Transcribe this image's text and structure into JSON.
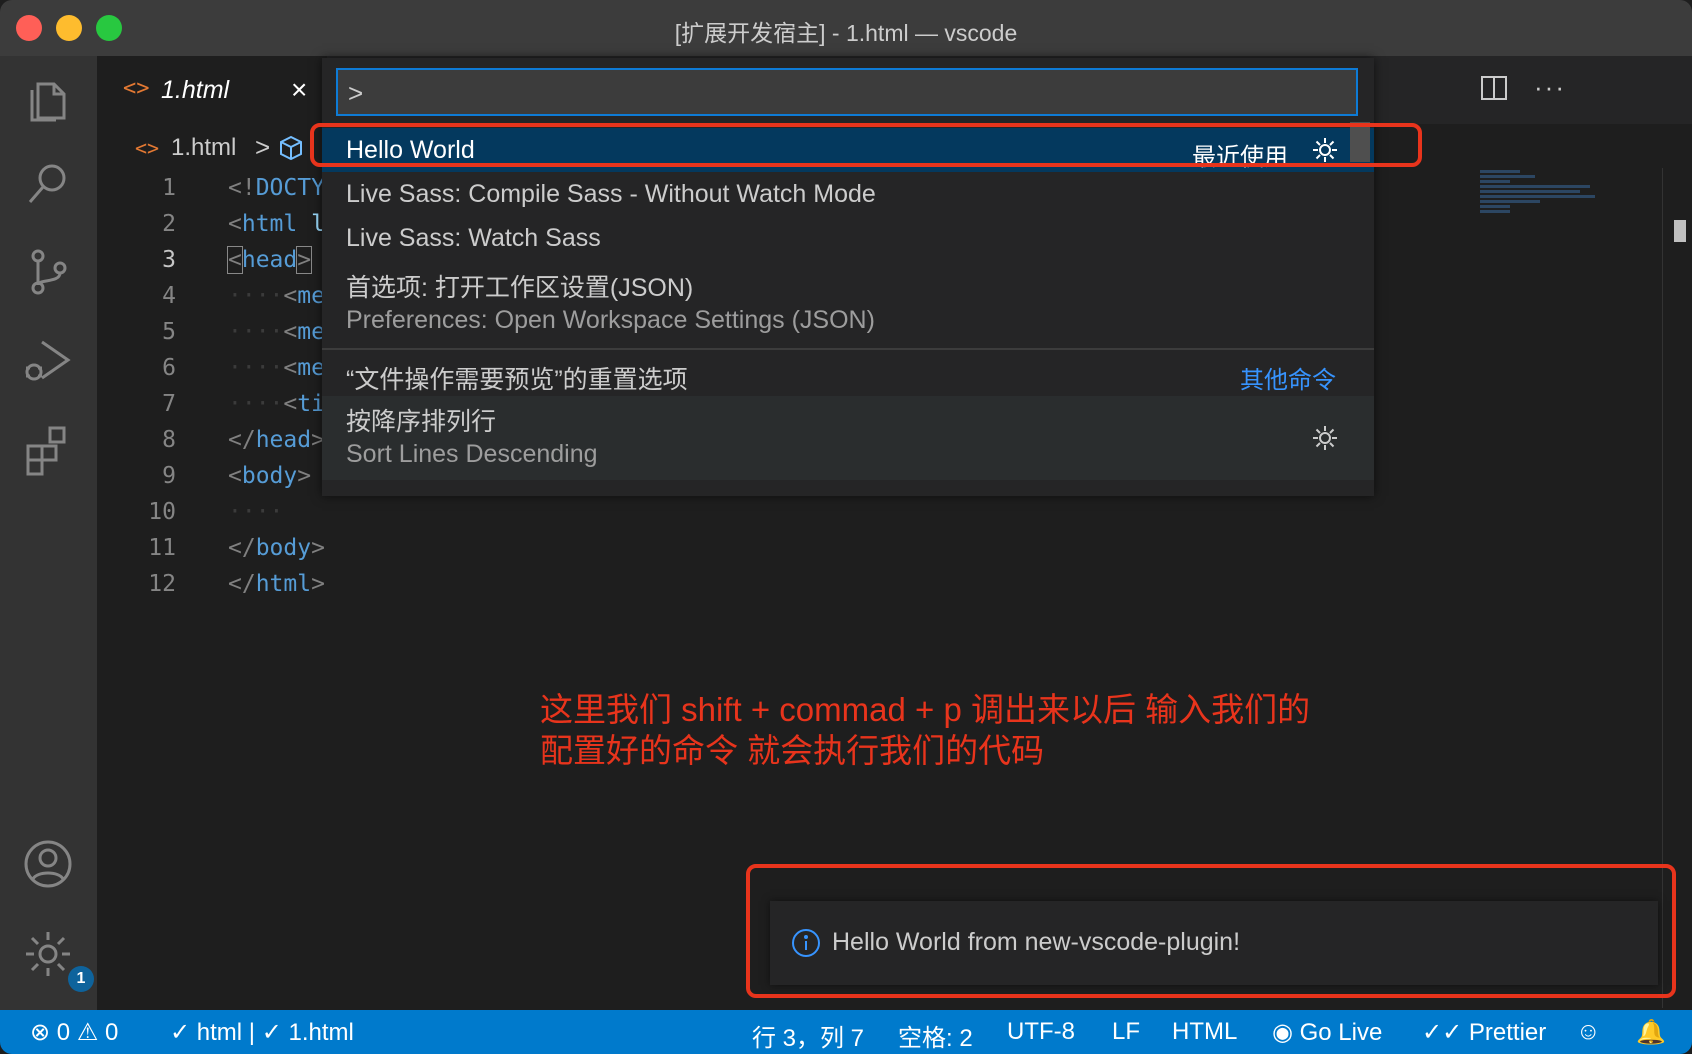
{
  "window": {
    "title": "[扩展开发宿主] - 1.html — vscode"
  },
  "activity_bar": {
    "items": [
      "files-icon",
      "search-icon",
      "source-control-icon",
      "run-debug-icon",
      "extensions-icon"
    ],
    "bottom": [
      "account-icon",
      "manage-gear-icon"
    ],
    "manage_badge": "1"
  },
  "tab": {
    "icon": "<>",
    "label": "1.html",
    "close": "×"
  },
  "breadcrumb": {
    "file_icon": "<>",
    "file": "1.html",
    "separator": ">"
  },
  "editor": {
    "line_numbers": [
      "1",
      "2",
      "3",
      "4",
      "5",
      "6",
      "7",
      "8",
      "9",
      "10",
      "11",
      "12"
    ],
    "active_line": "3",
    "lines": {
      "l1_a": "<!",
      "l1_b": "DOCTY",
      "l2_a": "<",
      "l2_b": "html",
      "l2_c": " l",
      "l3_a": "<",
      "l3_b": "head",
      "l3_c": ">",
      "l4_dots": "····",
      "l4_a": "<",
      "l4_b": "me",
      "l5_dots": "····",
      "l5_a": "<",
      "l5_b": "me",
      "l6_dots": "····",
      "l6_a": "<",
      "l6_b": "me",
      "l7_dots": "····",
      "l7_a": "<",
      "l7_b": "ti",
      "l8_a": "</",
      "l8_b": "head",
      "l8_c": ">",
      "l9_a": "<",
      "l9_b": "body",
      "l9_c": ">",
      "l10_dots": "····",
      "l11_a": "</",
      "l11_b": "body",
      "l11_c": ">",
      "l12_a": "</",
      "l12_b": "html",
      "l12_c": ">"
    }
  },
  "command_palette": {
    "input_value": ">",
    "items": [
      {
        "label": "Hello World",
        "tag": "最近使用"
      },
      {
        "label": "Live Sass: Compile Sass - Without Watch Mode"
      },
      {
        "label": "Live Sass: Watch Sass"
      },
      {
        "label": "首选项: 打开工作区设置(JSON)",
        "detail": "Preferences: Open Workspace Settings (JSON)"
      },
      {
        "label": "“文件操作需要预览”的重置选项",
        "tag": "其他命令"
      },
      {
        "label": "按降序排列行",
        "detail": "Sort Lines Descending"
      }
    ]
  },
  "annotation": {
    "line1": "这里我们 shift + commad + p 调出来以后 输入我们的",
    "line2": "配置好的命令 就会执行我们的代码",
    "color": "#e8341c"
  },
  "notification": {
    "message": "Hello World from new-vscode-plugin!"
  },
  "status_bar": {
    "errors": "0",
    "warnings": "0",
    "language_check": "html | ✓ 1.html",
    "position": "行 3，列 7",
    "spaces": "空格: 2",
    "encoding": "UTF-8",
    "eol": "LF",
    "language": "HTML",
    "go_live": "Go Live",
    "prettier": "Prettier",
    "color": "#007acc"
  }
}
